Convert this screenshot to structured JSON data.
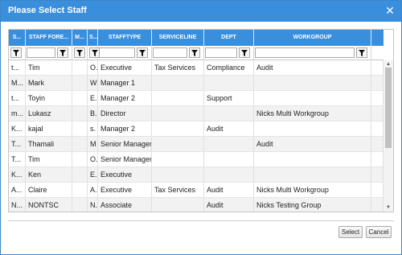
{
  "dialog": {
    "title": "Please Select Staff",
    "close_symbol": "✕"
  },
  "grid": {
    "columns": [
      "S...",
      "STAFF FORE...",
      "M...",
      "S...",
      "STAFFTYPE",
      "SERVICELINE",
      "DEPT",
      "WORKGROUP"
    ],
    "rows": [
      [
        "t...",
        "Tim",
        "",
        "O.",
        "Executive",
        "Tax Services",
        "Compliance",
        "Audit"
      ],
      [
        "M...",
        "Mark",
        "",
        "W",
        "Manager 1",
        "",
        "",
        ""
      ],
      [
        "t...",
        "Toyin",
        "",
        "E.",
        "Manager 2",
        "",
        "Support",
        ""
      ],
      [
        "m...",
        "Lukasz",
        "",
        "B.",
        "Director",
        "",
        "",
        "Nicks Multi Workgroup"
      ],
      [
        "K...",
        "kajal",
        "",
        "s.",
        "Manager 2",
        "",
        "Audit",
        ""
      ],
      [
        "T...",
        "Thamali",
        "",
        "M",
        "Senior Manager",
        "",
        "",
        "Audit"
      ],
      [
        "T...",
        "Tim",
        "",
        "O.",
        "Senior Manager",
        "",
        "",
        ""
      ],
      [
        "K...",
        "Ken",
        "",
        "E.",
        "Executive",
        "",
        "",
        ""
      ],
      [
        "A...",
        "Claire",
        "",
        "A.",
        "Executive",
        "Tax Services",
        "Audit",
        "Nicks Multi Workgroup"
      ],
      [
        "N...",
        "NONTSC",
        "",
        "N.",
        "Associate",
        "",
        "Audit",
        "Nicks Testing Group"
      ]
    ]
  },
  "buttons": {
    "select": "Select",
    "cancel": "Cancel"
  },
  "colors": {
    "accent": "#3a8fdd"
  },
  "icons": {
    "filter": "filter-icon",
    "close": "close-icon"
  }
}
